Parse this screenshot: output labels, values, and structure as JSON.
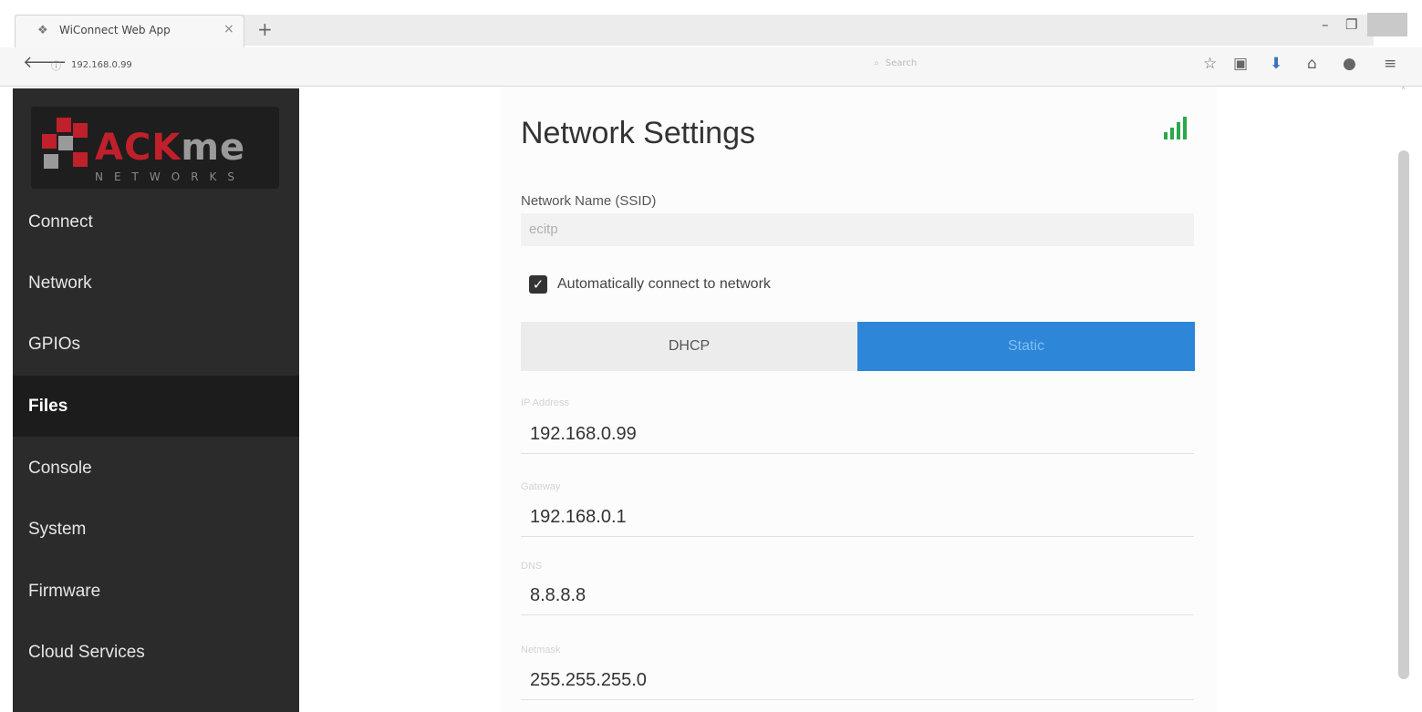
{
  "browser": {
    "tab_title": "WiConnect Web App",
    "tab_close": "×",
    "new_tab": "+",
    "url": "192.168.0.99",
    "search_placeholder": "Search",
    "icons": [
      "star-icon",
      "clipboard-icon",
      "download-icon",
      "home-icon",
      "chat-icon",
      "menu-icon"
    ],
    "window_controls": [
      "minimize",
      "maximize",
      "close"
    ]
  },
  "logo": {
    "brand": "ACKme",
    "sub": "NETWORKS",
    "colors": {
      "red": "#c0202b",
      "gray": "#9a9a9a"
    }
  },
  "sidebar": {
    "items": [
      {
        "label": "Connect",
        "active": false
      },
      {
        "label": "Network",
        "active": false
      },
      {
        "label": "GPIOs",
        "active": false
      },
      {
        "label": "Files",
        "active": true
      },
      {
        "label": "Console",
        "active": false
      },
      {
        "label": "System",
        "active": false
      },
      {
        "label": "Firmware",
        "active": false
      },
      {
        "label": "Cloud Services",
        "active": false
      }
    ]
  },
  "main": {
    "title": "Network Settings",
    "signal_icon": "wifi-signal-icon",
    "ssid_label": "Network Name (SSID)",
    "ssid_value": "ecitp",
    "auto_connect_label": "Automatically connect to network",
    "auto_connect_checked": true,
    "mode_dhcp_label": "DHCP",
    "mode_static_label": "Static",
    "fields": [
      {
        "label": "IP Address",
        "value": "192.168.0.99"
      },
      {
        "label": "Gateway",
        "value": "192.168.0.1"
      },
      {
        "label": "DNS",
        "value": "8.8.8.8"
      },
      {
        "label": "Netmask",
        "value": "255.255.255.0"
      }
    ]
  },
  "colors": {
    "sidebar_bg": "#2b2b2b",
    "accent": "#2e86d8",
    "signal": "#2aa84a"
  }
}
